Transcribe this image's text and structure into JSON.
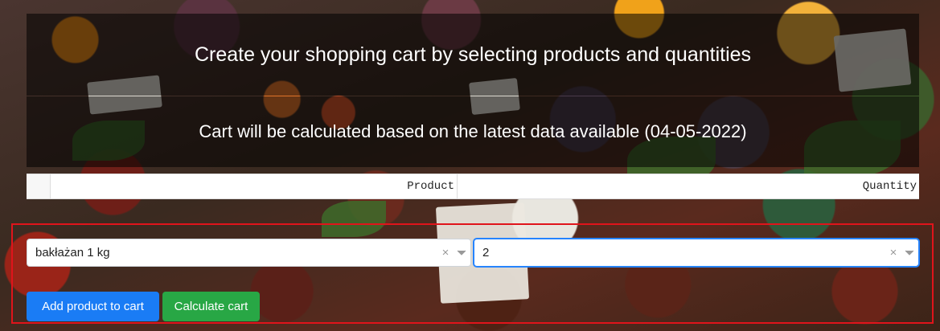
{
  "header": {
    "title": "Create your shopping cart by selecting products and quantities",
    "subtitle": "Cart will be calculated based on the latest data available (04-05-2022)"
  },
  "cart_table": {
    "columns": [
      "",
      "Product",
      "Quantity"
    ]
  },
  "form": {
    "product_select": {
      "value": "bakłażan 1 kg",
      "clear_glyph": "×"
    },
    "quantity_select": {
      "value": "2",
      "clear_glyph": "×"
    },
    "add_button_label": "Add product to cart",
    "calculate_button_label": "Calculate cart"
  },
  "colors": {
    "banner_bg": "rgba(0,0,0,0.55)",
    "primary": "#1a7cf5",
    "success": "#28a745",
    "highlight_border": "#e0141b",
    "focus": "#2684ff"
  },
  "icons": {
    "product_clear": "close-icon",
    "product_dropdown": "chevron-down-icon",
    "quantity_clear": "close-icon",
    "quantity_dropdown": "chevron-down-icon"
  }
}
